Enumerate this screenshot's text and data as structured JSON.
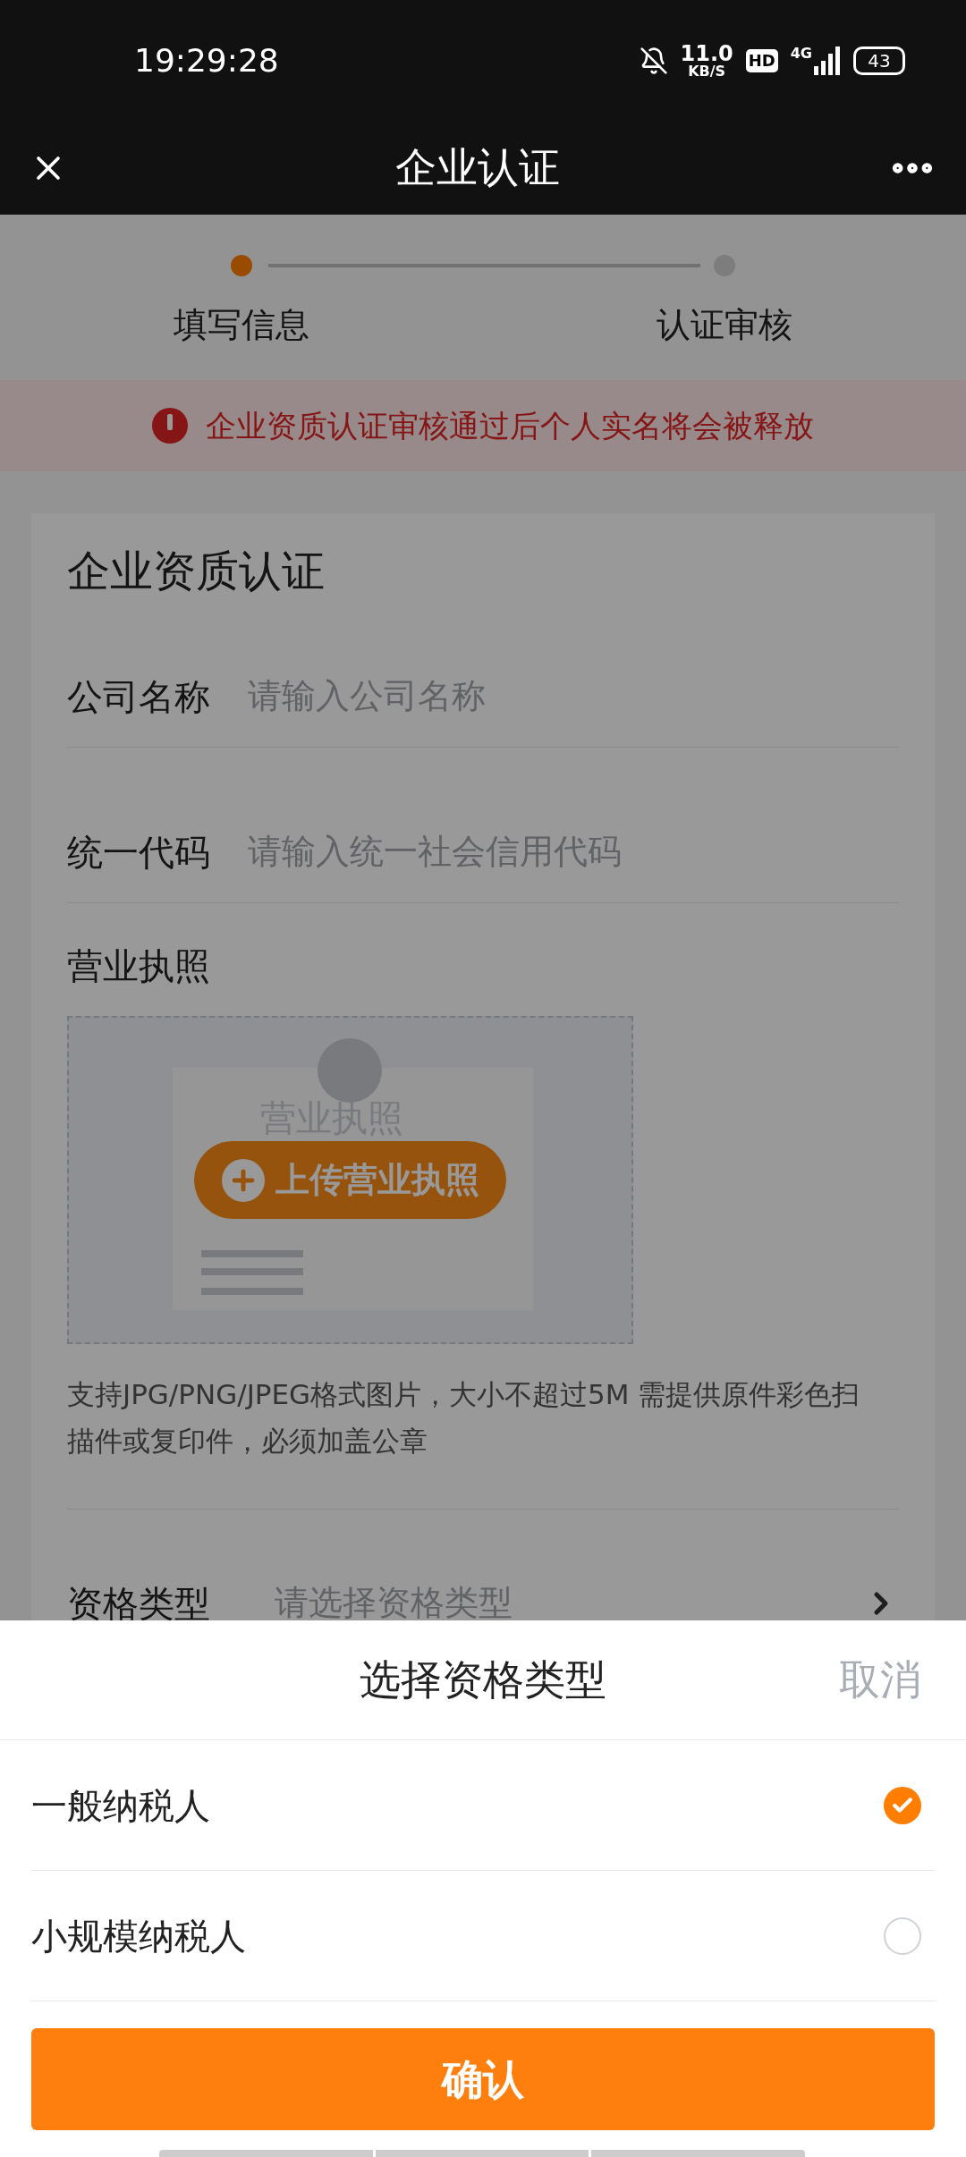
{
  "status_bar": {
    "time": "19:29:28",
    "net_speed": "11.0",
    "net_speed_unit": "KB/S",
    "hd_badge": "HD",
    "network": "4G",
    "battery": "43"
  },
  "header": {
    "title": "企业认证"
  },
  "steps": [
    {
      "label": "填写信息",
      "selected": true
    },
    {
      "label": "认证审核",
      "selected": false
    }
  ],
  "notice": {
    "text": "企业资质认证审核通过后个人实名将会被释放"
  },
  "card": {
    "title": "企业资质认证",
    "fields": [
      {
        "label": "公司名称",
        "placeholder": "请输入公司名称"
      },
      {
        "label": "统一代码",
        "placeholder": "请输入统一社会信用代码"
      }
    ],
    "license": {
      "label": "营业执照",
      "sample_text": "营业执照",
      "upload_button": "上传营业执照",
      "hint": "支持JPG/PNG/JPEG格式图片，大小不超过5M 需提供原件彩色扫描件或复印件，必须加盖公章"
    },
    "qualification": {
      "label": "资格类型",
      "placeholder": "请选择资格类型"
    }
  },
  "sheet": {
    "title": "选择资格类型",
    "cancel": "取消",
    "options": [
      {
        "label": "一般纳税人",
        "selected": true
      },
      {
        "label": "小规模纳税人",
        "selected": false
      }
    ],
    "confirm": "确认"
  }
}
